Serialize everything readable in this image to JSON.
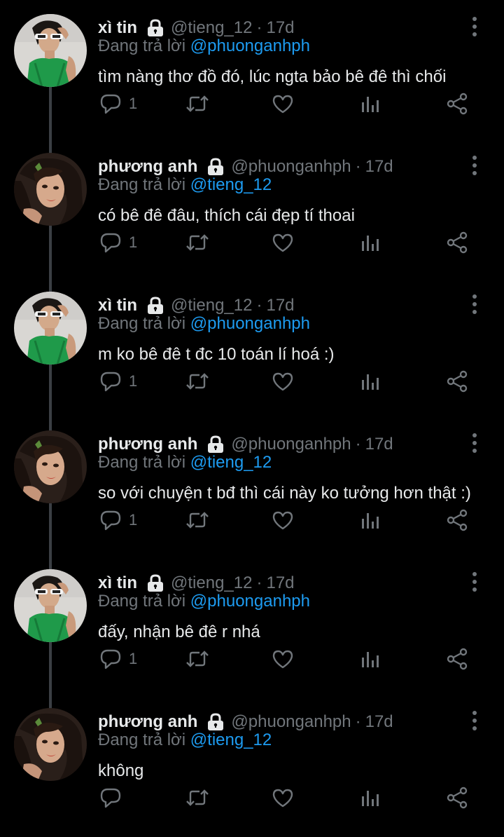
{
  "colors": {
    "background": "#000000",
    "text": "#e7e9ea",
    "muted": "#71767b",
    "accent": "#1d9bf0",
    "connector": "#3b3f44"
  },
  "icons": {
    "lock": "lock-icon",
    "more": "more-vertical-icon",
    "reply": "reply-icon",
    "retweet": "retweet-icon",
    "like": "heart-icon",
    "stats": "stats-icon",
    "share": "share-icon"
  },
  "tweets": [
    {
      "name": "xì tin",
      "handle": "@tieng_12",
      "dot": "·",
      "time": "17d",
      "reply_prefix": "Đang trả lời",
      "reply_to": "@phuonganhph",
      "text": "tìm nàng thơ đồ đó, lúc ngta bảo bê đê thì chối",
      "reply_count": "1"
    },
    {
      "name": "phương anh",
      "handle": "@phuonganhph",
      "dot": "·",
      "time": "17d",
      "reply_prefix": "Đang trả lời",
      "reply_to": "@tieng_12",
      "text": "có bê đê đâu, thích cái đẹp tí thoai",
      "reply_count": "1"
    },
    {
      "name": "xì tin",
      "handle": "@tieng_12",
      "dot": "·",
      "time": "17d",
      "reply_prefix": "Đang trả lời",
      "reply_to": "@phuonganhph",
      "text": "m ko bê đê t đc 10 toán lí hoá :)",
      "reply_count": "1"
    },
    {
      "name": "phương anh",
      "handle": "@phuonganhph",
      "dot": "·",
      "time": "17d",
      "reply_prefix": "Đang trả lời",
      "reply_to": "@tieng_12",
      "text": "so với chuyện t bđ thì cái này ko tưởng hơn thật :)",
      "reply_count": "1"
    },
    {
      "name": "xì tin",
      "handle": "@tieng_12",
      "dot": "·",
      "time": "17d",
      "reply_prefix": "Đang trả lời",
      "reply_to": "@phuonganhph",
      "text": "đấy, nhận bê đê r nhá",
      "reply_count": "1"
    },
    {
      "name": "phương anh",
      "handle": "@phuonganhph",
      "dot": "·",
      "time": "17d",
      "reply_prefix": "Đang trả lời",
      "reply_to": "@tieng_12",
      "text": "không",
      "reply_count": ""
    }
  ]
}
